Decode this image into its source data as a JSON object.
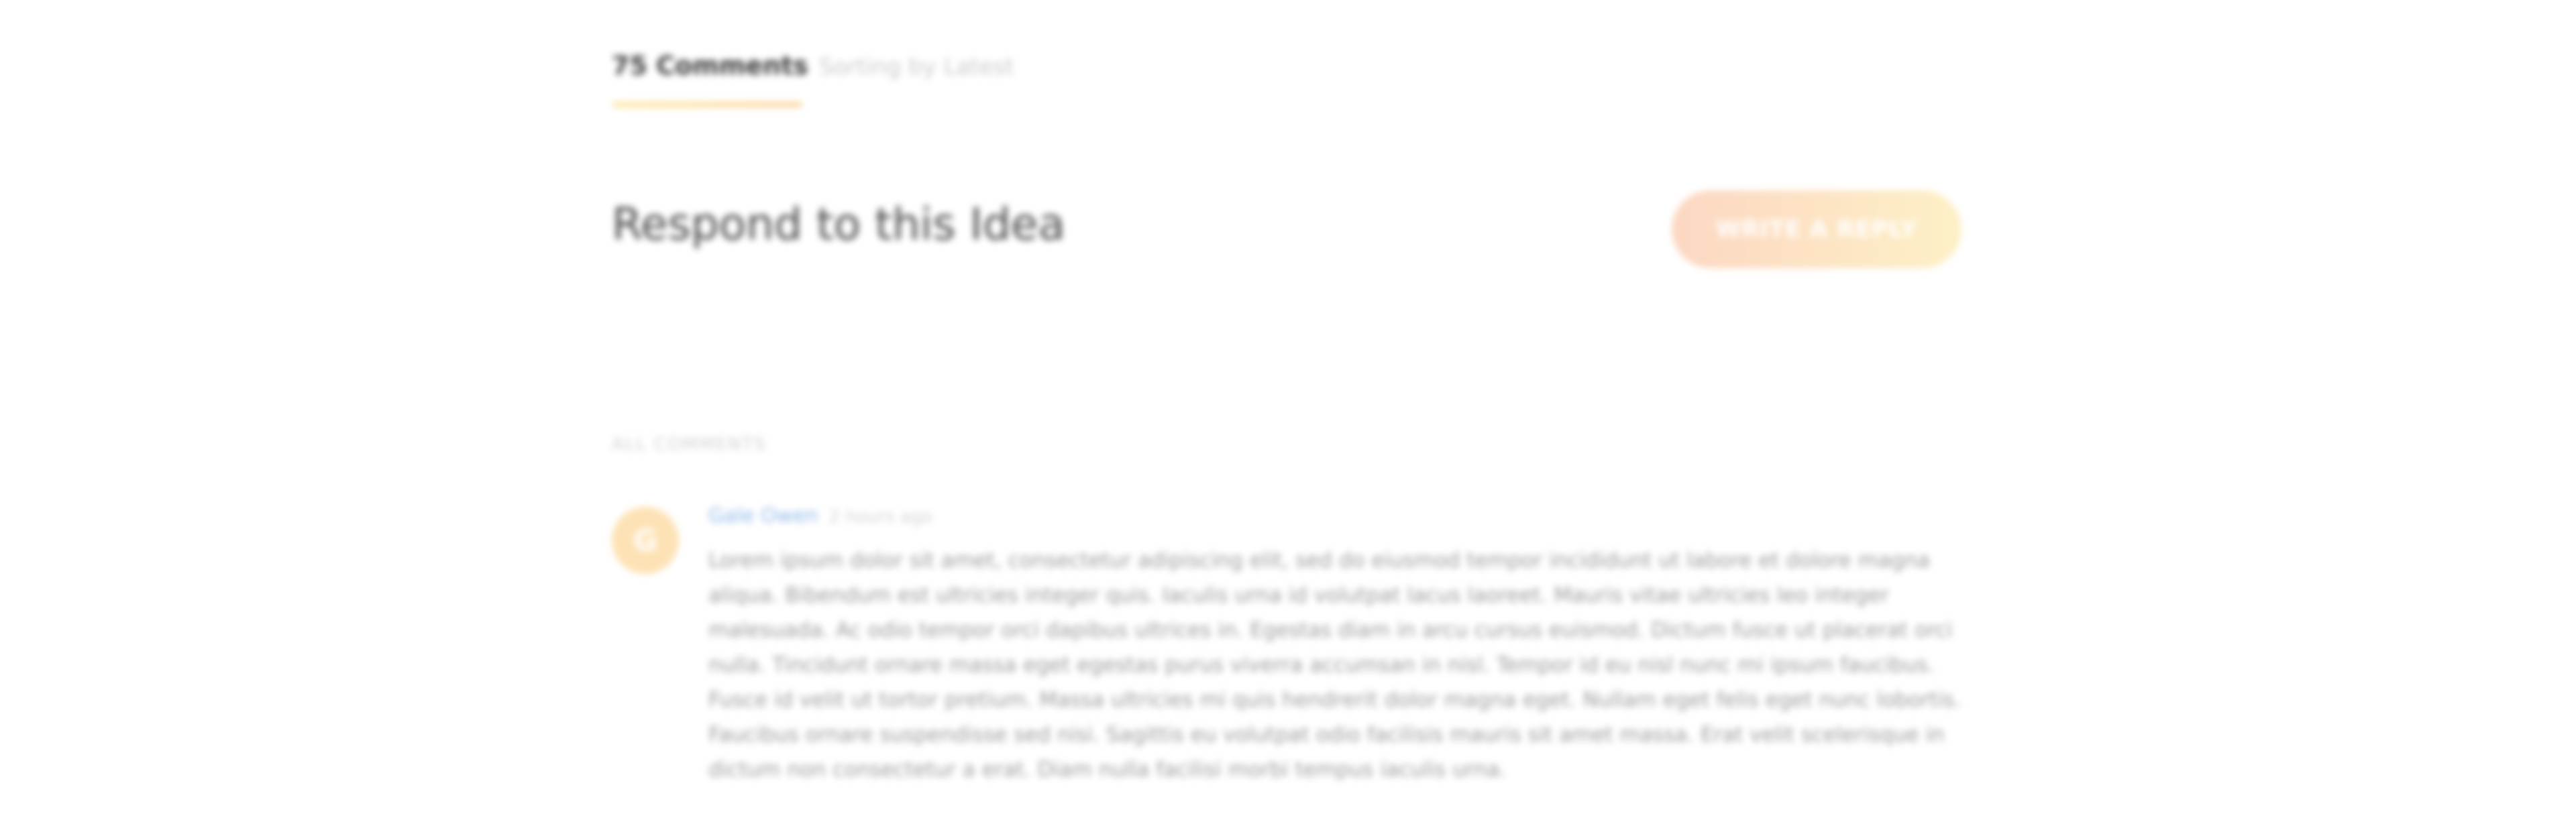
{
  "comments": {
    "count_label": "75 Comments",
    "sort_label": "Sorting by Latest"
  },
  "respond": {
    "title": "Respond to this Idea",
    "reply_button": "WRITE A REPLY"
  },
  "section": {
    "label": "ALL COMMENTS"
  },
  "comment": {
    "avatar_initial": "G",
    "author": "Gale Owen",
    "time": "2 hours ago",
    "text": "Lorem ipsum dolor sit amet, consectetur adipiscing elit, sed do eiusmod tempor incididunt ut labore et dolore magna aliqua. Bibendum est ultricies integer quis. Iaculis urna id volutpat lacus laoreet. Mauris vitae ultricies leo integer malesuada. Ac odio tempor orci dapibus ultrices in. Egestas diam in arcu cursus euismod. Dictum fusce ut placerat orci nulla. Tincidunt ornare massa eget egestas purus viverra accumsan in nisl. Tempor id eu nisl nunc mi ipsum faucibus. Fusce id velit ut tortor pretium. Massa ultricies mi quis hendrerit dolor magna eget. Nullam eget felis eget nunc lobortis. Faucibus ornare suspendisse sed nisi. Sagittis eu volutpat odio facilisis mauris sit amet massa. Erat velit scelerisque in dictum non consectetur a erat. Diam nulla facilisi morbi tempus iaculis urna."
  },
  "colors": {
    "accent_start": "#fcd7c2",
    "accent_end": "#fdf0c6",
    "author_link": "#8fb8e8",
    "avatar_bg": "#fde2b5"
  }
}
